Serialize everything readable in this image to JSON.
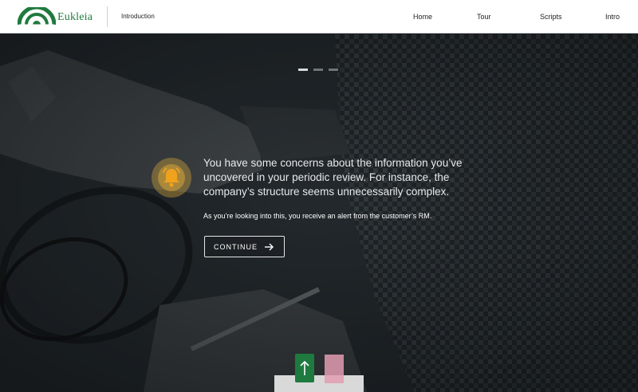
{
  "header": {
    "brand": "Eukleia",
    "section_title": "Introduction",
    "nav": [
      {
        "label": "Home"
      },
      {
        "label": "Tour"
      },
      {
        "label": "Scripts"
      },
      {
        "label": "Intro"
      }
    ]
  },
  "hero": {
    "slide_indicators": [
      "slide-1",
      "slide-2",
      "slide-3"
    ],
    "active_slide": 1,
    "icon": "bell-icon",
    "message": "You have some concerns about the information you’ve uncovered in your periodic review. For instance, the company’s structure seems unnecessarily complex.",
    "sub_message": "As you’re looking into this, you receive an alert from the customer’s RM.",
    "continue_label": "CONTINUE"
  },
  "colors": {
    "brand_green": "#1f7a3e",
    "accent_gold": "#d6a63a",
    "button_border": "#e6e6e6"
  }
}
